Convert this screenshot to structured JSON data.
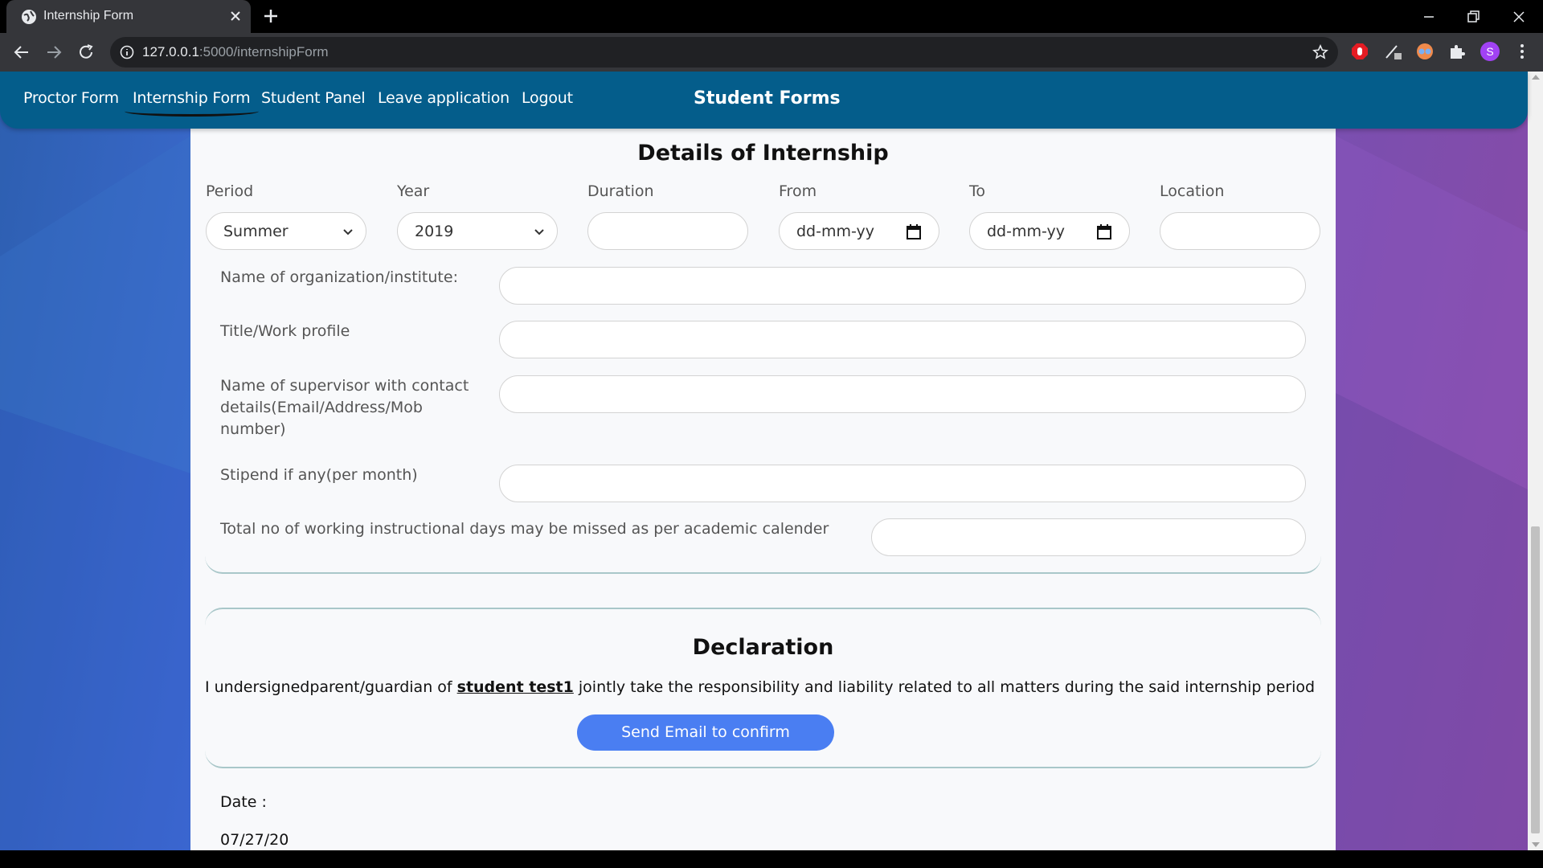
{
  "browser": {
    "tab_title": "Internship Form",
    "url_host": "127.0.0.1",
    "url_path": ":5000/internshipForm",
    "profile_initial": "S"
  },
  "nav": {
    "links": [
      "Proctor Form",
      "Internship Form",
      "Student Panel",
      "Leave application",
      "Logout"
    ],
    "brand": "Student Forms"
  },
  "internship": {
    "title": "Details of Internship",
    "fields": {
      "period": {
        "label": "Period",
        "value": "Summer"
      },
      "year": {
        "label": "Year",
        "value": "2019"
      },
      "duration": {
        "label": "Duration",
        "value": ""
      },
      "from": {
        "label": "From",
        "placeholder": "dd-mm-yy"
      },
      "to": {
        "label": "To",
        "placeholder": "dd-mm-yy"
      },
      "location": {
        "label": "Location",
        "value": ""
      }
    },
    "rows": {
      "organization": "Name of organization/institute:",
      "title_profile": "Title/Work profile",
      "supervisor": "Name of supervisor with contact details(Email/Address/Mob number)",
      "stipend": "Stipend if any(per month)",
      "days_missed": "Total no of working instructional days may be missed as per academic calender"
    }
  },
  "declaration": {
    "title": "Declaration",
    "text_before": "I undersignedparent/guardian of ",
    "student_name": "student test1",
    "text_after": " jointly take the responsibility and liability related to all matters during the said internship period",
    "button": "Send Email to confirm"
  },
  "date": {
    "label": "Date :",
    "value": "07/27/20"
  },
  "colors": {
    "nav_bg": "#045d8b",
    "button_bg": "#4a7ef2",
    "card_border": "#a9c7c9"
  }
}
